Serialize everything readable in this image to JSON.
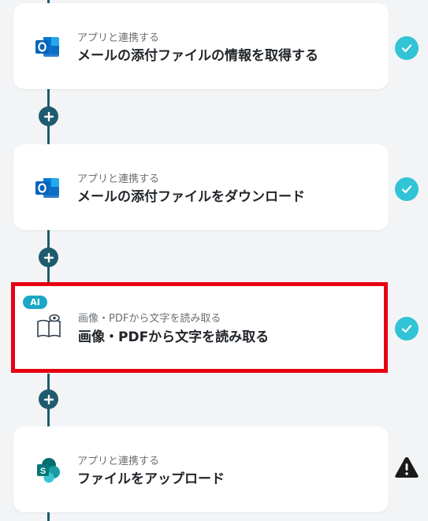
{
  "flow": {
    "steps": [
      {
        "subtitle": "アプリと連携する",
        "title": "メールの添付ファイルの情報を取得する",
        "icon": "outlook-icon",
        "status": "complete"
      },
      {
        "subtitle": "アプリと連携する",
        "title": "メールの添付ファイルをダウンロード",
        "icon": "outlook-icon",
        "status": "complete"
      },
      {
        "badge": "AI",
        "subtitle": "画像・PDFから文字を読み取る",
        "title": "画像・PDFから文字を読み取る",
        "icon": "ocr-book-eye-icon",
        "status": "complete",
        "highlighted": true
      },
      {
        "subtitle": "アプリと連携する",
        "title": "ファイルをアップロード",
        "icon": "sharepoint-icon",
        "status": "warning"
      }
    ]
  },
  "colors": {
    "connector": "#1f5b6e",
    "check_badge": "#31c3d6",
    "ai_badge": "#1aa7c6",
    "highlight_border": "#e60012",
    "warning": "#1a1a1a"
  }
}
